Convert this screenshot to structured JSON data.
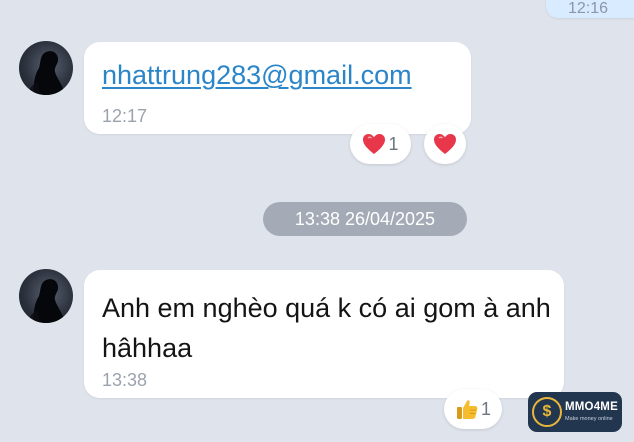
{
  "previous_message": {
    "time": "12:16"
  },
  "messages": [
    {
      "text": "nhattrung283@gmail.com",
      "time": "12:17",
      "reactions": [
        {
          "icon": "heart-icon",
          "count": "1"
        },
        {
          "icon": "heart-icon",
          "count": ""
        }
      ]
    },
    {
      "text": "Anh em nghèo quá k có ai gom à anh hâhhaa",
      "time": "13:38",
      "reactions": [
        {
          "icon": "thumbs-up-icon",
          "count": "1"
        }
      ]
    }
  ],
  "date_separator": "13:38 26/04/2025",
  "watermark": {
    "name": "MMO4ME",
    "tagline": "Make money online"
  },
  "colors": {
    "background": "#dfe3ec",
    "bubble_incoming": "#ffffff",
    "bubble_outgoing": "#d9ebff",
    "link": "#2a85c9",
    "heart": "#e8364a",
    "date_pill": "#a4abb6"
  }
}
